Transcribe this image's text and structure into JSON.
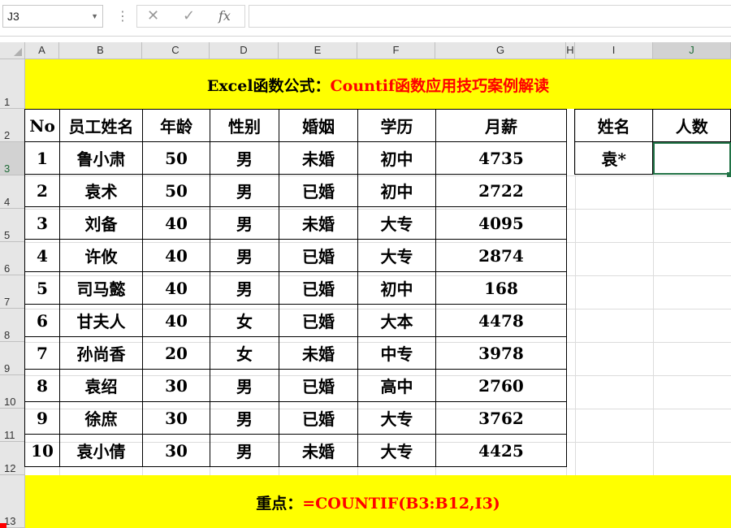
{
  "formula_bar": {
    "name_box": "J3",
    "cancel_icon": "✕",
    "enter_icon": "✓",
    "fx_label": "fx",
    "formula": ""
  },
  "columns": [
    "A",
    "B",
    "C",
    "D",
    "E",
    "F",
    "G",
    "H",
    "I",
    "J"
  ],
  "rows": [
    "1",
    "2",
    "3",
    "4",
    "5",
    "6",
    "7",
    "8",
    "9",
    "10",
    "11",
    "12",
    "13"
  ],
  "title": {
    "part1": "Excel函数公式：",
    "part2": "Countif函数应用技巧案例解读"
  },
  "table": {
    "headers": [
      "No",
      "员工姓名",
      "年龄",
      "性别",
      "婚姻",
      "学历",
      "月薪"
    ],
    "rows": [
      [
        "1",
        "鲁小肃",
        "50",
        "男",
        "未婚",
        "初中",
        "4735"
      ],
      [
        "2",
        "袁术",
        "50",
        "男",
        "已婚",
        "初中",
        "2722"
      ],
      [
        "3",
        "刘备",
        "40",
        "男",
        "未婚",
        "大专",
        "4095"
      ],
      [
        "4",
        "许攸",
        "40",
        "男",
        "已婚",
        "大专",
        "2874"
      ],
      [
        "5",
        "司马懿",
        "40",
        "男",
        "已婚",
        "初中",
        "168"
      ],
      [
        "6",
        "甘夫人",
        "40",
        "女",
        "已婚",
        "大本",
        "4478"
      ],
      [
        "7",
        "孙尚香",
        "20",
        "女",
        "未婚",
        "中专",
        "3978"
      ],
      [
        "8",
        "袁绍",
        "30",
        "男",
        "已婚",
        "高中",
        "2760"
      ],
      [
        "9",
        "徐庶",
        "30",
        "男",
        "已婚",
        "大专",
        "3762"
      ],
      [
        "10",
        "袁小倩",
        "30",
        "男",
        "未婚",
        "大专",
        "4425"
      ]
    ]
  },
  "criteria": {
    "headers": [
      "姓名",
      "人数"
    ],
    "name_value": "袁*",
    "count_value": ""
  },
  "footer": {
    "part1": "重点：",
    "part2": "=COUNTIF(B3:B12,I3)"
  },
  "colors": {
    "highlight": "#ffff00",
    "title_red": "#ff0000",
    "selection": "#217346"
  }
}
